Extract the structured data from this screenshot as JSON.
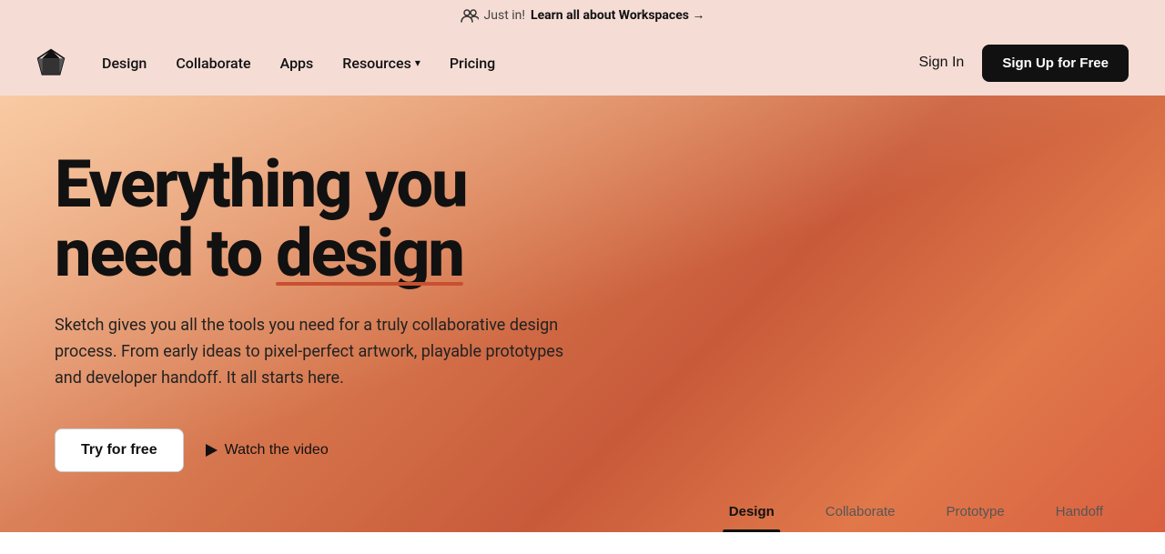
{
  "announcement": {
    "prefix": "Just in!",
    "link_text": "Learn all about Workspaces →",
    "users_icon": "users-icon"
  },
  "navbar": {
    "logo_alt": "Sketch logo",
    "nav_items": [
      {
        "label": "Design",
        "has_dropdown": false
      },
      {
        "label": "Collaborate",
        "has_dropdown": false
      },
      {
        "label": "Apps",
        "has_dropdown": false
      },
      {
        "label": "Resources",
        "has_dropdown": true
      },
      {
        "label": "Pricing",
        "has_dropdown": false
      }
    ],
    "sign_in_label": "Sign In",
    "sign_up_label": "Sign Up for Free"
  },
  "hero": {
    "title_part1": "Everything you",
    "title_part2": "need to ",
    "title_underline_word": "design",
    "subtitle": "Sketch gives you all the tools you need for a truly collaborative design process. From early ideas to pixel-perfect artwork, playable prototypes and developer handoff. It all starts here.",
    "cta_try": "Try for free",
    "cta_watch": "Watch the video",
    "tabs": [
      {
        "label": "Design",
        "active": true
      },
      {
        "label": "Collaborate",
        "active": false
      },
      {
        "label": "Prototype",
        "active": false
      },
      {
        "label": "Handoff",
        "active": false
      }
    ]
  },
  "colors": {
    "bg_announcement": "#f5ddd5",
    "bg_nav": "#f5ddd5",
    "hero_gradient_start": "#e8a07a",
    "hero_gradient_end": "#c85a3a",
    "text_dark": "#111111",
    "underline_color": "#c85030",
    "btn_primary_bg": "#111111",
    "btn_primary_text": "#ffffff",
    "btn_secondary_bg": "#ffffff"
  }
}
